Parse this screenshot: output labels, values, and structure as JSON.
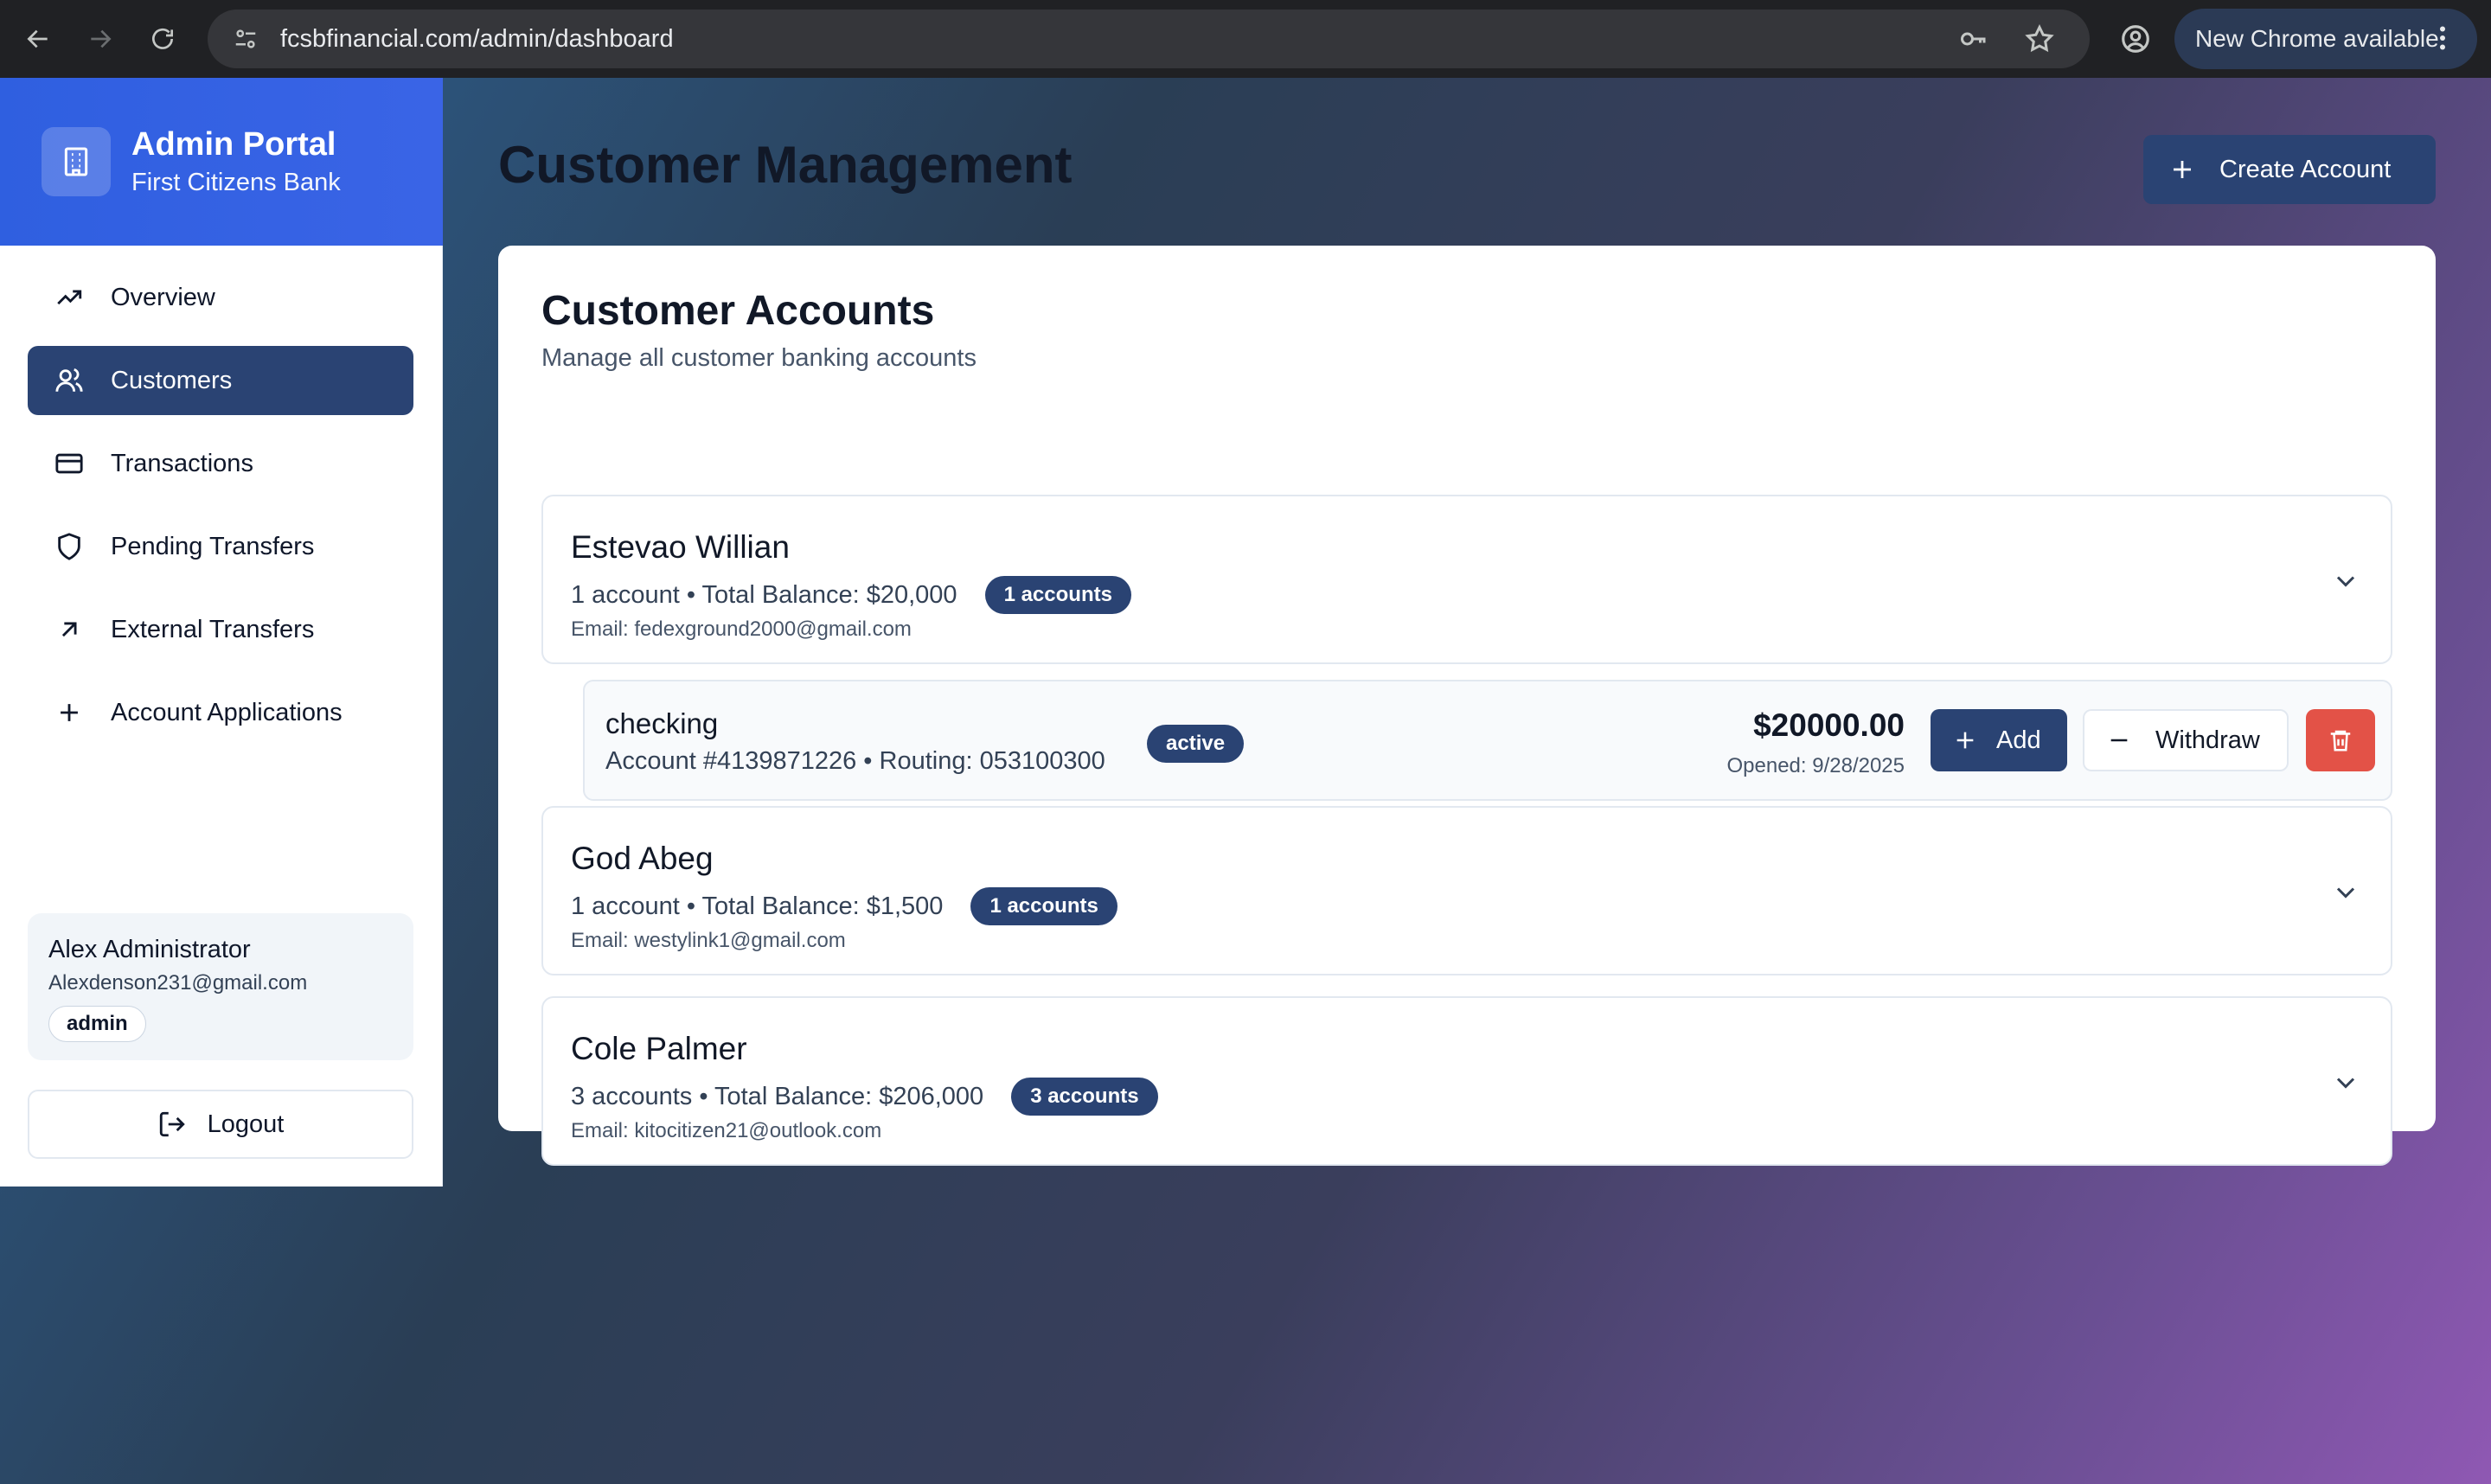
{
  "browser": {
    "url": "fcsbfinancial.com/admin/dashboard",
    "update_label": "New Chrome available"
  },
  "sidebar": {
    "title": "Admin Portal",
    "subtitle": "First Citizens Bank",
    "items": [
      {
        "label": "Overview",
        "icon": "trending-up-icon",
        "active": false
      },
      {
        "label": "Customers",
        "icon": "users-icon",
        "active": true
      },
      {
        "label": "Transactions",
        "icon": "credit-card-icon",
        "active": false
      },
      {
        "label": "Pending Transfers",
        "icon": "shield-icon",
        "active": false
      },
      {
        "label": "External Transfers",
        "icon": "arrow-up-right-icon",
        "active": false
      },
      {
        "label": "Account Applications",
        "icon": "plus-icon",
        "active": false
      }
    ],
    "user": {
      "name": "Alex Administrator",
      "email": "Alexdenson231@gmail.com",
      "role": "admin"
    },
    "logout_label": "Logout"
  },
  "main": {
    "title": "Customer Management",
    "create_label": "Create Account",
    "card_title": "Customer Accounts",
    "card_subtitle": "Manage all customer banking accounts",
    "customers": [
      {
        "name": "Estevao Willian",
        "summary": "1 account • Total Balance: $20,000",
        "badge": "1 accounts",
        "email": "Email: fedexground2000@gmail.com",
        "expanded": true
      },
      {
        "name": "God Abeg",
        "summary": "1 account • Total Balance: $1,500",
        "badge": "1 accounts",
        "email": "Email: westylink1@gmail.com",
        "expanded": false
      },
      {
        "name": "Cole Palmer",
        "summary": "3 accounts • Total Balance: $206,000",
        "badge": "3 accounts",
        "email": "Email: kitocitizen21@outlook.com",
        "expanded": false
      }
    ],
    "account": {
      "type": "checking",
      "details": "Account #4139871226 • Routing: 053100300",
      "status": "active",
      "balance": "$20000.00",
      "opened": "Opened: 9/28/2025",
      "add_label": "Add",
      "withdraw_label": "Withdraw"
    }
  },
  "colors": {
    "brand_blue": "#3a64e6",
    "primary_navy": "#2a4373",
    "danger_red": "#e35247"
  }
}
